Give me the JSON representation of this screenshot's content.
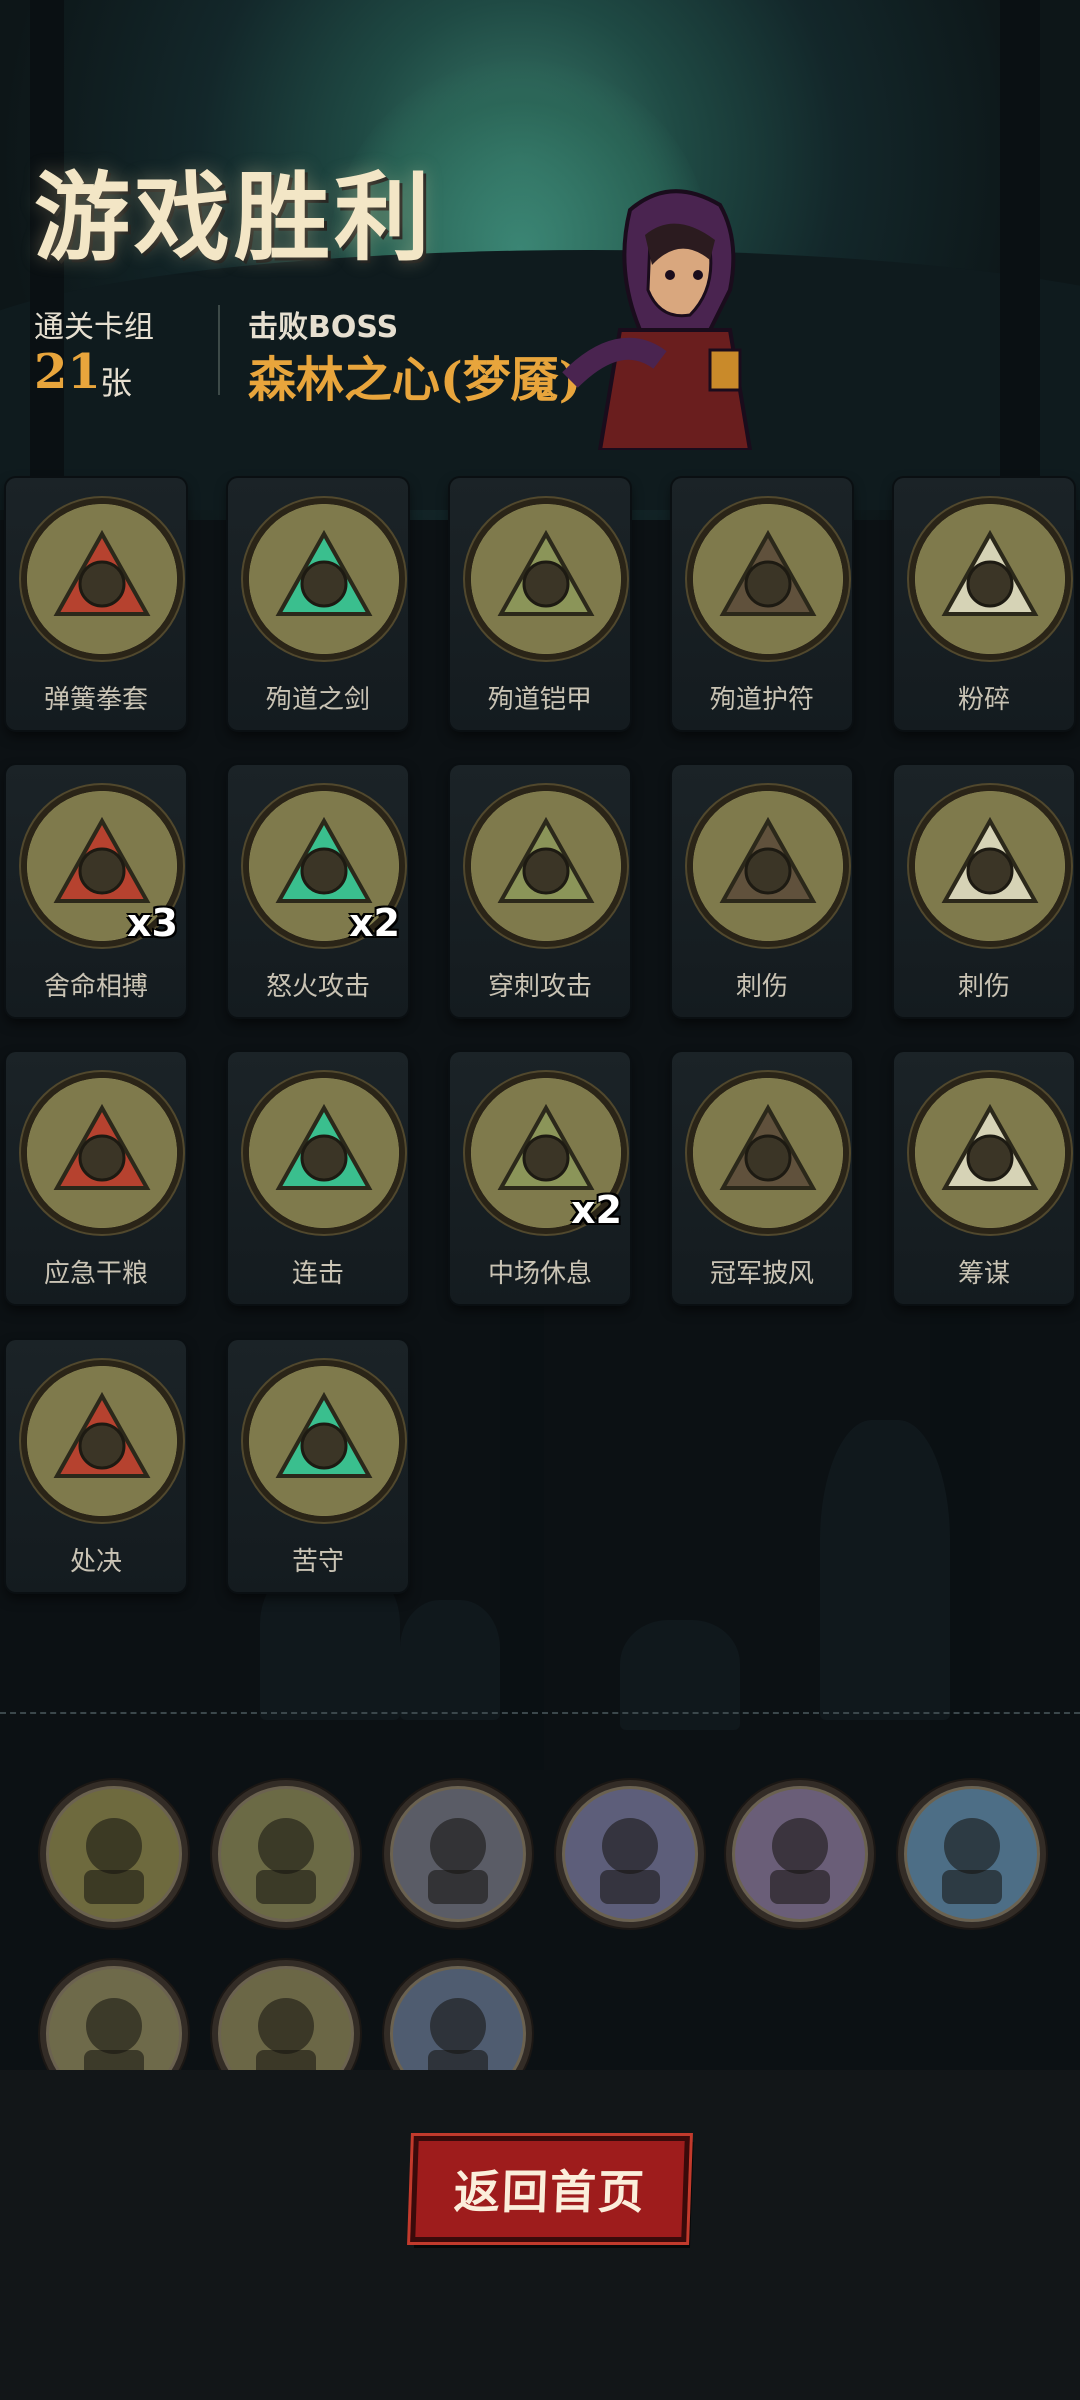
{
  "header": {
    "title": "游戏胜利",
    "deck_label": "通关卡组",
    "deck_count": "21",
    "deck_unit": "张",
    "boss_label": "击败BOSS",
    "boss_name": "森林之心(梦魇)"
  },
  "cards": [
    {
      "name": "弹簧拳套",
      "icon": "spring-glove-icon",
      "multiplier": ""
    },
    {
      "name": "殉道之剑",
      "icon": "martyr-sword-icon",
      "multiplier": ""
    },
    {
      "name": "殉道铠甲",
      "icon": "martyr-armor-icon",
      "multiplier": ""
    },
    {
      "name": "殉道护符",
      "icon": "martyr-amulet-icon",
      "multiplier": ""
    },
    {
      "name": "粉碎",
      "icon": "smash-icon",
      "multiplier": ""
    },
    {
      "name": "舍命相搏",
      "icon": "desperate-fight-icon",
      "multiplier": "x3"
    },
    {
      "name": "怒火攻击",
      "icon": "rage-attack-icon",
      "multiplier": "x2"
    },
    {
      "name": "穿刺攻击",
      "icon": "pierce-attack-icon",
      "multiplier": ""
    },
    {
      "name": "刺伤",
      "icon": "stab-icon",
      "multiplier": ""
    },
    {
      "name": "刺伤",
      "icon": "stab-icon",
      "multiplier": ""
    },
    {
      "name": "应急干粮",
      "icon": "ration-icon",
      "multiplier": ""
    },
    {
      "name": "连击",
      "icon": "combo-icon",
      "multiplier": ""
    },
    {
      "name": "中场休息",
      "icon": "intermission-icon",
      "multiplier": "x2"
    },
    {
      "name": "冠军披风",
      "icon": "champion-cloak-icon",
      "multiplier": ""
    },
    {
      "name": "筹谋",
      "icon": "scheme-icon",
      "multiplier": ""
    },
    {
      "name": "处决",
      "icon": "execute-icon",
      "multiplier": ""
    },
    {
      "name": "苦守",
      "icon": "hold-out-icon",
      "multiplier": ""
    }
  ],
  "relics": [
    {
      "icon": "beast-skull-relic-icon",
      "color": "#6e6a3e"
    },
    {
      "icon": "campfire-knight-relic-icon",
      "color": "#6b6a45"
    },
    {
      "icon": "bleeding-fist-relic-icon",
      "color": "#5a5c66"
    },
    {
      "icon": "wolf-rider-relic-icon",
      "color": "#5d5e7a"
    },
    {
      "icon": "vampire-relic-icon",
      "color": "#6a5e78"
    },
    {
      "icon": "dagger-relic-icon",
      "color": "#4d6e86"
    },
    {
      "icon": "boxing-ring-relic-icon",
      "color": "#6e6a4a"
    },
    {
      "icon": "goblin-cart-relic-icon",
      "color": "#6b6746"
    },
    {
      "icon": "ghost-ogre-relic-icon",
      "color": "#4f5c70"
    }
  ],
  "footer": {
    "return_label": "返回首页"
  },
  "colors": {
    "accent": "#e8a53c",
    "button": "#9e1c1c",
    "title": "#f3e6c6"
  }
}
